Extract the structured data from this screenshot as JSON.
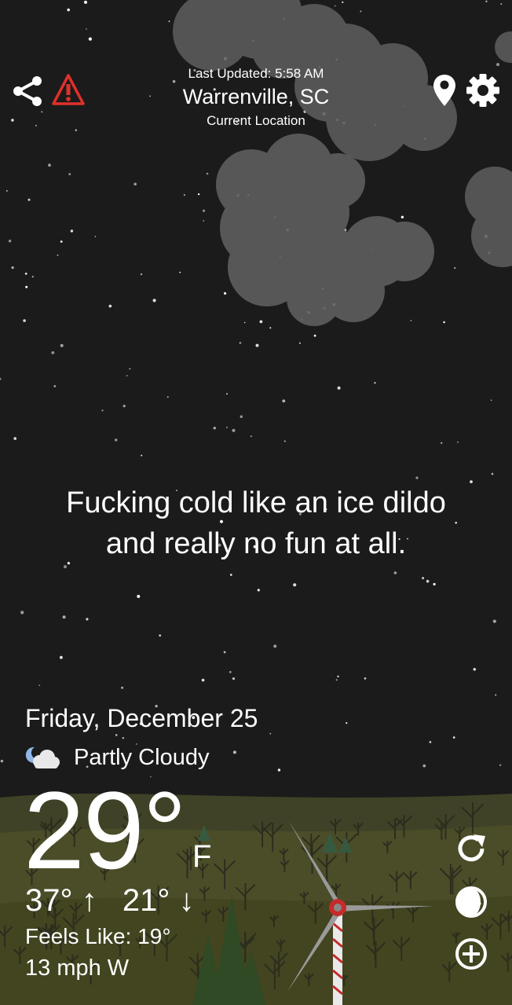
{
  "header": {
    "last_updated": "Last Updated: 5:58 AM",
    "city": "Warrenville, SC",
    "location_label": "Current Location"
  },
  "icons": {
    "share": "share-icon",
    "alert": "warning-triangle-icon",
    "location": "location-pin-icon",
    "settings": "gear-icon",
    "condition": "partly-cloudy-night-icon",
    "refresh": "refresh-icon",
    "moon": "moon-phase-icon",
    "add": "add-circle-icon"
  },
  "colors": {
    "sky": "#1b1b1b",
    "alert": "#e0302a",
    "hills": "#4a4c2a"
  },
  "quote": {
    "line1": "Fucking cold like an ice dildo",
    "line2": "and really no fun at all."
  },
  "weather": {
    "date": "Friday, December 25",
    "condition": "Partly Cloudy",
    "temperature": "29°",
    "unit": "F",
    "high": "37°",
    "high_arrow": "↑",
    "low": "21°",
    "low_arrow": "↓",
    "feels_like": "Feels Like: 19°",
    "wind": "13 mph W"
  }
}
